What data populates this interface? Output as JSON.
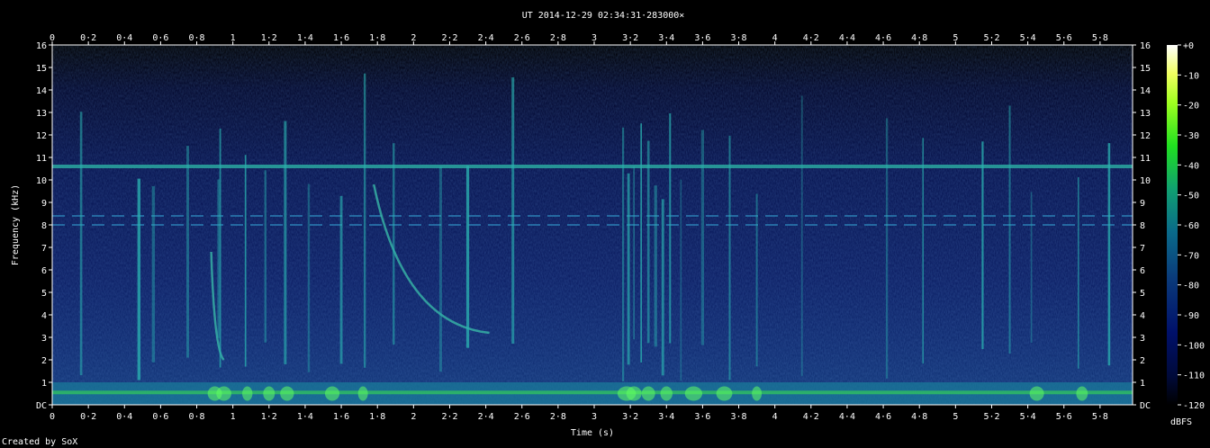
{
  "chart_data": {
    "type": "heatmap",
    "title": "UT 2014-12-29 02:34:31·283000×",
    "xlabel": "Time (s)",
    "ylabel": "Frequency (kHz)",
    "xlim": [
      0,
      5.98
    ],
    "ylim": [
      0,
      16
    ],
    "x_ticks": [
      "0",
      "0·2",
      "0·4",
      "0·6",
      "0·8",
      "1",
      "1·2",
      "1·4",
      "1·6",
      "1·8",
      "2",
      "2·2",
      "2·4",
      "2·6",
      "2·8",
      "3",
      "3·2",
      "3·4",
      "3·6",
      "3·8",
      "4",
      "4·2",
      "4·4",
      "4·6",
      "4·8",
      "5",
      "5·2",
      "5·4",
      "5·6",
      "5·8"
    ],
    "y_ticks": [
      "DC",
      "1",
      "2",
      "3",
      "4",
      "5",
      "6",
      "7",
      "8",
      "9",
      "10",
      "11",
      "12",
      "13",
      "14",
      "15",
      "16"
    ],
    "colorbar": {
      "label": "dBFS",
      "range": [
        -120,
        0
      ],
      "ticks": [
        "+0",
        "-10",
        "-20",
        "-30",
        "-40",
        "-50",
        "-60",
        "-70",
        "-80",
        "-90",
        "-100",
        "-110",
        "-120"
      ]
    },
    "features": [
      {
        "kind": "horizontal-line",
        "freq_khz": 10.6,
        "level_dbfs": -75
      },
      {
        "kind": "horizontal-dashed-line",
        "freq_khz": 8.4,
        "level_dbfs": -85
      },
      {
        "kind": "horizontal-dashed-line",
        "freq_khz": 8.0,
        "level_dbfs": -85
      },
      {
        "kind": "low-frequency-band",
        "freq_khz": [
          0,
          1
        ],
        "level_dbfs": -65
      },
      {
        "kind": "falling-tone",
        "t_start": 0.88,
        "f_start": 6.8,
        "t_end": 0.95,
        "f_end": 2.0
      },
      {
        "kind": "falling-tone",
        "t_start": 1.78,
        "f_start": 9.8,
        "t_end": 2.42,
        "f_end": 3.2
      }
    ],
    "credit": "Created by SoX"
  }
}
